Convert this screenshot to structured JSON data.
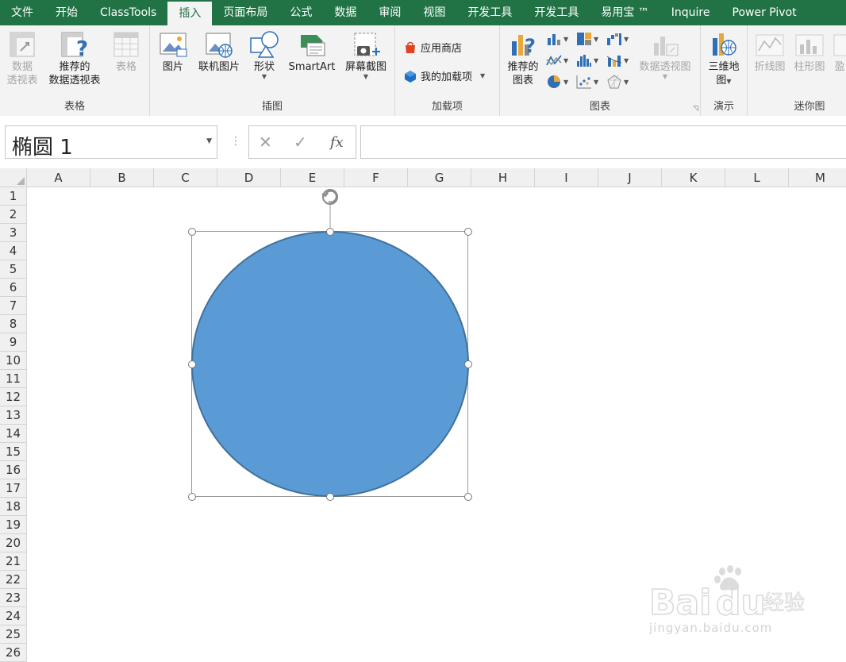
{
  "tabs": [
    "文件",
    "开始",
    "ClassTools",
    "插入",
    "页面布局",
    "公式",
    "数据",
    "审阅",
    "视图",
    "开发工具",
    "开发工具",
    "易用宝 ™",
    "Inquire",
    "Power Pivot"
  ],
  "active_tab": "插入",
  "ribbon": {
    "tables": {
      "label": "表格",
      "pivot_line1": "数据",
      "pivot_line2": "透视表",
      "recommended_line1": "推荐的",
      "recommended_line2": "数据透视表",
      "table": "表格"
    },
    "illustrations": {
      "label": "插图",
      "pictures": "图片",
      "online_pictures": "联机图片",
      "shapes": "形状",
      "smartart": "SmartArt",
      "screenshot": "屏幕截图"
    },
    "addins": {
      "label": "加载项",
      "store": "应用商店",
      "my_addins": "我的加载项"
    },
    "charts": {
      "label": "图表",
      "recommended_line1": "推荐的",
      "recommended_line2": "图表",
      "pivot_chart": "数据透视图"
    },
    "tours": {
      "label": "演示",
      "map_line1": "三维地",
      "map_line2": "图"
    },
    "sparklines": {
      "label": "迷你图",
      "line": "折线图",
      "column": "柱形图",
      "winloss": "盈"
    }
  },
  "formula_bar": {
    "name_box": "椭圆 1",
    "cancel": "✕",
    "enter": "✓",
    "fx": "fx",
    "value": ""
  },
  "columns": [
    "A",
    "B",
    "C",
    "D",
    "E",
    "F",
    "G",
    "H",
    "I",
    "J",
    "K",
    "L",
    "M"
  ],
  "rows": [
    "1",
    "2",
    "3",
    "4",
    "5",
    "6",
    "7",
    "8",
    "9",
    "10",
    "11",
    "12",
    "13",
    "14",
    "15",
    "16",
    "17",
    "18",
    "19",
    "20",
    "21",
    "22",
    "23",
    "24",
    "25",
    "26"
  ],
  "shape": {
    "name": "椭圆 1",
    "fill": "#5B9BD5",
    "stroke": "#41719C"
  },
  "watermark": {
    "url": "jingyan.baidu.com"
  },
  "colors": {
    "accent": "#217346",
    "ribbon_bg": "#f3f3f3"
  }
}
